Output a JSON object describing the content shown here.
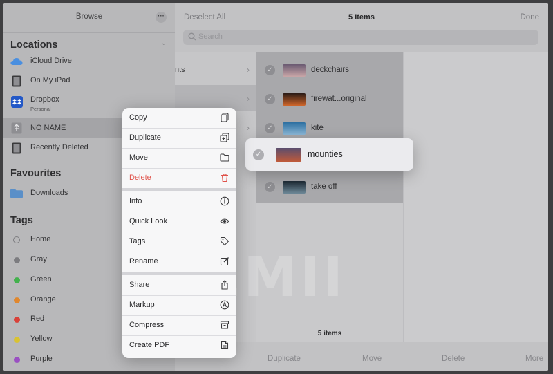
{
  "sidebar": {
    "title": "Browse",
    "more_glyph": "···",
    "locations": {
      "title": "Locations",
      "items": [
        {
          "label": "iCloud Drive",
          "icon": "cloud-icon"
        },
        {
          "label": "On My iPad",
          "icon": "ipad-icon"
        },
        {
          "label": "Dropbox",
          "sub": "Personal",
          "icon": "dropbox-icon"
        },
        {
          "label": "NO NAME",
          "icon": "usb-drive-icon",
          "selected": true
        },
        {
          "label": "Recently Deleted",
          "icon": "trash-icon"
        }
      ]
    },
    "favourites": {
      "title": "Favourites",
      "items": [
        {
          "label": "Downloads",
          "icon": "folder-icon"
        }
      ]
    },
    "tags": {
      "title": "Tags",
      "items": [
        {
          "label": "Home",
          "color": ""
        },
        {
          "label": "Gray",
          "color": "#7c7c80"
        },
        {
          "label": "Green",
          "color": "#43b14d"
        },
        {
          "label": "Orange",
          "color": "#e0872e"
        },
        {
          "label": "Red",
          "color": "#d84139"
        },
        {
          "label": "Yellow",
          "color": "#d9c232"
        },
        {
          "label": "Purple",
          "color": "#9a50c2"
        }
      ]
    }
  },
  "topbar": {
    "deselect": "Deselect All",
    "count": "5 Items",
    "done": "Done"
  },
  "search": {
    "placeholder": "Search"
  },
  "column1": {
    "fragment": "nts"
  },
  "files": [
    {
      "name": "deckchairs",
      "thumb": [
        "#6a5a72",
        "#c9a6a8"
      ]
    },
    {
      "name": "firewat...original",
      "thumb": [
        "#2a1b16",
        "#d0662a"
      ]
    },
    {
      "name": "kite",
      "thumb": [
        "#2c6fa1",
        "#8bb7d7"
      ]
    },
    {
      "name": "mounties",
      "thumb": [
        "#5a4d6e",
        "#c05a3a"
      ]
    },
    {
      "name": "take off",
      "thumb": [
        "#1e2a35",
        "#6c8796"
      ]
    }
  ],
  "drag_item": {
    "name": "mounties"
  },
  "footer": {
    "count": "5 items"
  },
  "bottombar": {
    "duplicate": "Duplicate",
    "move": "Move",
    "delete": "Delete",
    "more": "More"
  },
  "menu": {
    "group1": [
      {
        "label": "Copy",
        "icon": "copy-icon"
      },
      {
        "label": "Duplicate",
        "icon": "duplicate-icon"
      },
      {
        "label": "Move",
        "icon": "folder-icon"
      },
      {
        "label": "Delete",
        "icon": "trash-icon",
        "destructive": true
      }
    ],
    "group2": [
      {
        "label": "Info",
        "icon": "info-icon"
      },
      {
        "label": "Quick Look",
        "icon": "eye-icon"
      },
      {
        "label": "Tags",
        "icon": "tag-icon"
      },
      {
        "label": "Rename",
        "icon": "pencil-icon"
      }
    ],
    "group3": [
      {
        "label": "Share",
        "icon": "share-icon"
      },
      {
        "label": "Markup",
        "icon": "markup-icon"
      },
      {
        "label": "Compress",
        "icon": "archive-icon"
      },
      {
        "label": "Create PDF",
        "icon": "pdf-icon"
      }
    ]
  },
  "watermark": "EMII",
  "colors": {
    "destructive": "#e0524a",
    "sidebar_bg": "#b8b8ba",
    "menu_bg": "#f7f7f8"
  }
}
